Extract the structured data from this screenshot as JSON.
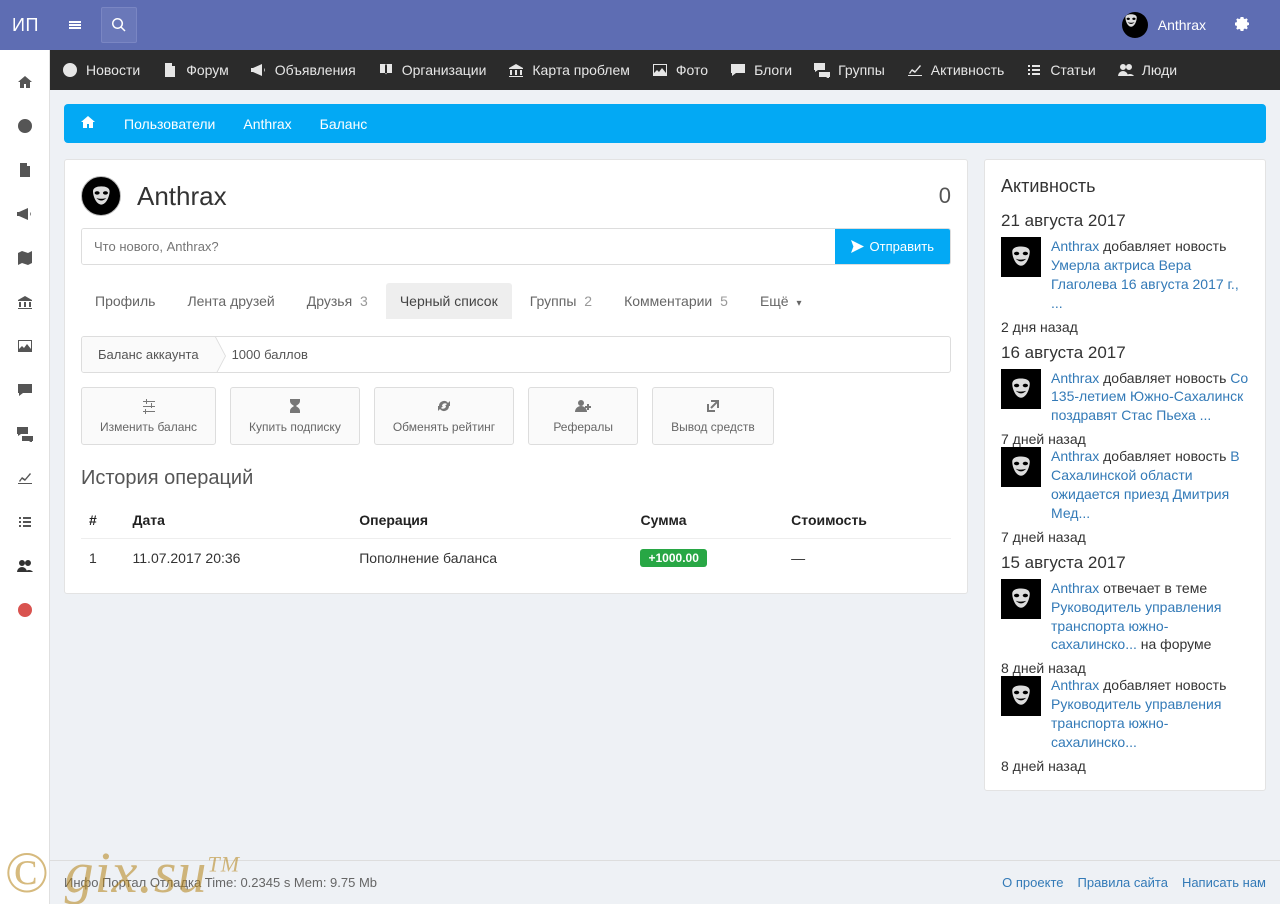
{
  "logo": "ИП",
  "user": {
    "name": "Anthrax"
  },
  "nav": [
    {
      "icon": "exclaim-circle",
      "label": "Новости"
    },
    {
      "icon": "file",
      "label": "Форум"
    },
    {
      "icon": "bullhorn",
      "label": "Объявления"
    },
    {
      "icon": "book",
      "label": "Организации"
    },
    {
      "icon": "bank",
      "label": "Карта проблем"
    },
    {
      "icon": "image",
      "label": "Фото"
    },
    {
      "icon": "comment",
      "label": "Блоги"
    },
    {
      "icon": "comments",
      "label": "Группы"
    },
    {
      "icon": "chart",
      "label": "Активность"
    },
    {
      "icon": "list",
      "label": "Статьи"
    },
    {
      "icon": "users",
      "label": "Люди"
    }
  ],
  "breadcrumbs": [
    "Пользователи",
    "Anthrax",
    "Баланс"
  ],
  "profile": {
    "name": "Anthrax",
    "count": "0"
  },
  "compose": {
    "placeholder": "Что нового, Anthrax?",
    "submit": "Отправить"
  },
  "tabs": [
    {
      "label": "Профиль"
    },
    {
      "label": "Лента друзей"
    },
    {
      "label": "Друзья",
      "count": "3"
    },
    {
      "label": "Черный список",
      "active": true
    },
    {
      "label": "Группы",
      "count": "2"
    },
    {
      "label": "Комментарии",
      "count": "5"
    },
    {
      "label": "Ещё",
      "more": true
    }
  ],
  "balance": {
    "label": "Баланс аккаунта",
    "value": "1000 баллов"
  },
  "actions": [
    {
      "icon": "sliders",
      "label": "Изменить баланс"
    },
    {
      "icon": "hourglass",
      "label": "Купить подписку"
    },
    {
      "icon": "refresh",
      "label": "Обменять рейтинг"
    },
    {
      "icon": "user-plus",
      "label": "Рефералы"
    },
    {
      "icon": "external",
      "label": "Вывод средств"
    }
  ],
  "history": {
    "title": "История операций",
    "cols": [
      "#",
      "Дата",
      "Операция",
      "Сумма",
      "Стоимость"
    ],
    "rows": [
      {
        "n": "1",
        "date": "11.07.2017 20:36",
        "op": "Пополнение баланса",
        "sum": "+1000.00",
        "cost": "—"
      }
    ]
  },
  "activity": {
    "title": "Активность",
    "groups": [
      {
        "date": "21 августа 2017",
        "items": [
          {
            "user": "Anthrax",
            "verb": "добавляет новость",
            "link": "Умерла актриса Вера Глаголева 16 августа 2017 г., ...",
            "time": "2 дня назад"
          }
        ]
      },
      {
        "date": "16 августа 2017",
        "items": [
          {
            "user": "Anthrax",
            "verb": "добавляет новость",
            "link": "Со 135-летием Южно-Сахалинск поздравят Стас Пьеха ...",
            "time": "7 дней назад"
          },
          {
            "user": "Anthrax",
            "verb": "добавляет новость",
            "link": "В Сахалинской области ожидается приезд Дмитрия Мед...",
            "time": "7 дней назад"
          }
        ]
      },
      {
        "date": "15 августа 2017",
        "items": [
          {
            "user": "Anthrax",
            "verb": "отвечает в теме",
            "link": "Руководитель управления транспорта южно-сахалинско...",
            "tail": "на форуме",
            "time": "8 дней назад"
          },
          {
            "user": "Anthrax",
            "verb": "добавляет новость",
            "link": "Руководитель управления транспорта южно-сахалинско...",
            "time": "8 дней назад"
          }
        ]
      }
    ]
  },
  "footer": {
    "debug": "Инфо Портал Отладка Time: 0.2345 s Mem: 9.75 Mb",
    "links": [
      "О проекте",
      "Правила сайта",
      "Написать нам"
    ]
  },
  "watermark": "© gix.su"
}
